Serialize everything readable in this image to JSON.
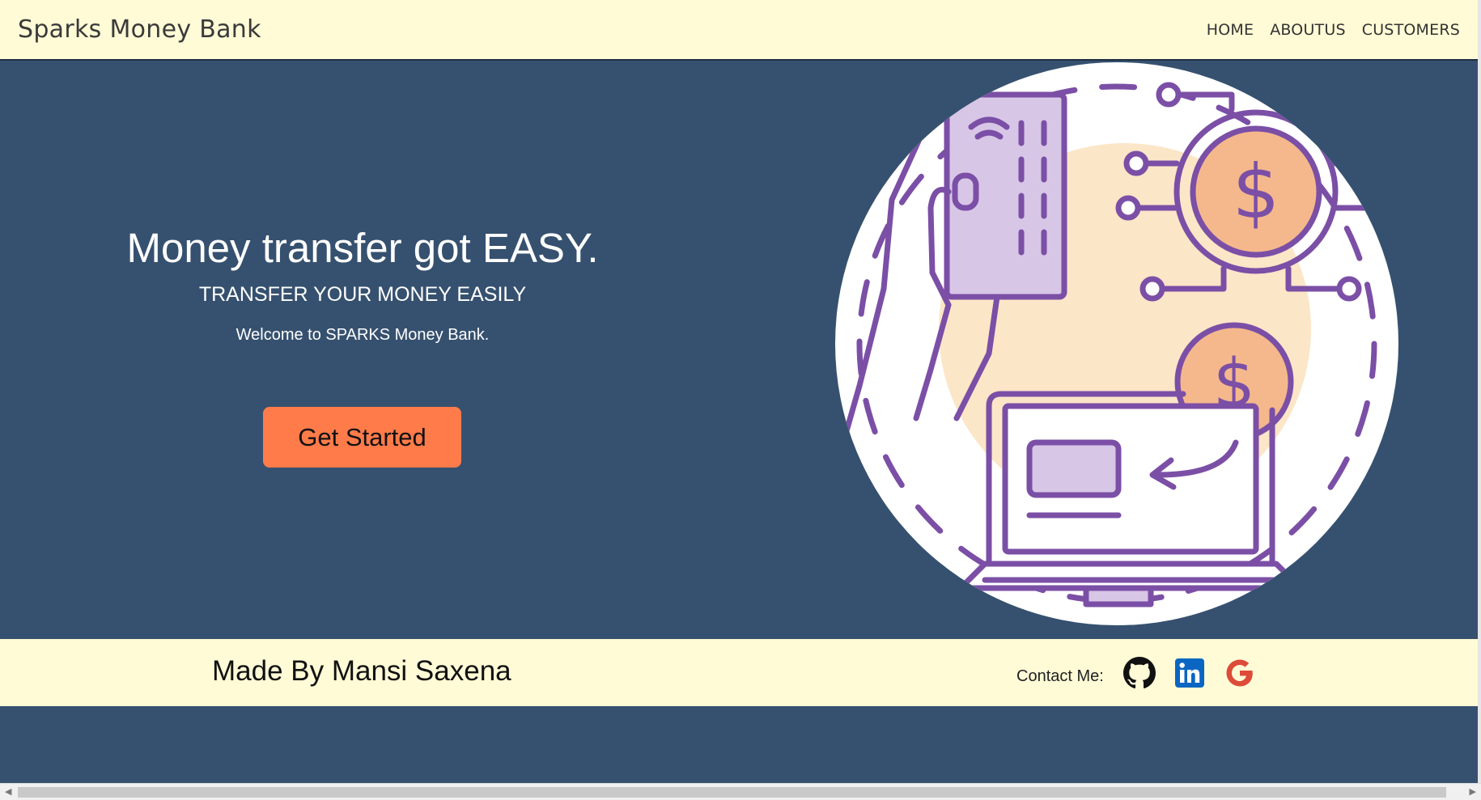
{
  "navbar": {
    "brand": "Sparks Money Bank",
    "links": [
      "HOME",
      "ABOUTUS",
      "CUSTOMERS"
    ]
  },
  "hero": {
    "title": "Money transfer got EASY.",
    "subtitle": "TRANSFER YOUR MONEY EASILY",
    "welcome": "Welcome to SPARKS Money Bank.",
    "cta_label": "Get Started"
  },
  "footer": {
    "credit": "Made By Mansi Saxena",
    "contact_label": "Contact Me:",
    "socials": [
      "github-icon",
      "linkedin-icon",
      "google-icon"
    ]
  },
  "colors": {
    "background": "#36516f",
    "navbar": "#fffbd6",
    "cta": "#ff7b4a",
    "illustration_purple": "#7b4fa6",
    "illustration_orange": "#f4b88c"
  }
}
